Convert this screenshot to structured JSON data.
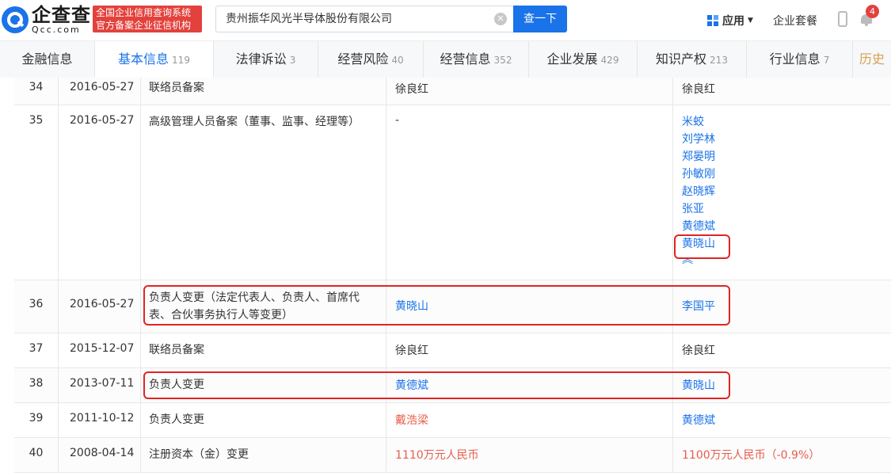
{
  "header": {
    "logo_cn": "企查查",
    "logo_en": "Qcc.com",
    "tag_line1": "全国企业信用查询系统",
    "tag_line2": "官方备案企业征信机构",
    "search_value": "贵州振华风光半导体股份有限公司",
    "search_button": "查一下",
    "app_menu": "应用",
    "enterprise_package": "企业套餐",
    "notification_count": "4"
  },
  "tabs": [
    {
      "label": "金融信息",
      "count": ""
    },
    {
      "label": "基本信息",
      "count": "119"
    },
    {
      "label": "法律诉讼",
      "count": "3"
    },
    {
      "label": "经营风险",
      "count": "40"
    },
    {
      "label": "经营信息",
      "count": "352"
    },
    {
      "label": "企业发展",
      "count": "429"
    },
    {
      "label": "知识产权",
      "count": "213"
    },
    {
      "label": "行业信息",
      "count": "7"
    },
    {
      "label": "历史",
      "count": ""
    }
  ],
  "rows": [
    {
      "idx": "34",
      "date": "2016-05-27",
      "item": "联络员备案",
      "before": "徐良红",
      "after": "徐良红"
    },
    {
      "idx": "35",
      "date": "2016-05-27",
      "item": "高级管理人员备案（董事、监事、经理等）",
      "before": "-",
      "after_list": [
        "米蛟",
        "刘学林",
        "郑晏明",
        "孙敏刚",
        "赵晓辉",
        "张亚",
        "黄德斌",
        "黄晓山"
      ]
    },
    {
      "idx": "36",
      "date": "2016-05-27",
      "item": "负责人变更（法定代表人、负责人、首席代表、合伙事务执行人等变更）",
      "before": "黄晓山",
      "after": "李国平"
    },
    {
      "idx": "37",
      "date": "2015-12-07",
      "item": "联络员备案",
      "before": "徐良红",
      "after": "徐良红"
    },
    {
      "idx": "38",
      "date": "2013-07-11",
      "item": "负责人变更",
      "before": "黄德斌",
      "after": "黄晓山"
    },
    {
      "idx": "39",
      "date": "2011-10-12",
      "item": "负责人变更",
      "before": "戴浩梁",
      "after": "黄德斌"
    },
    {
      "idx": "40",
      "date": "2008-04-14",
      "item": "注册资本（金）变更",
      "before": "1110万元人民币",
      "after": "1100万元人民币（-0.9%）"
    }
  ],
  "collapse_glyph": "︽",
  "colors": {
    "accent": "#1a73e8",
    "highlight": "#e02424",
    "red_text": "#e85c4a"
  }
}
